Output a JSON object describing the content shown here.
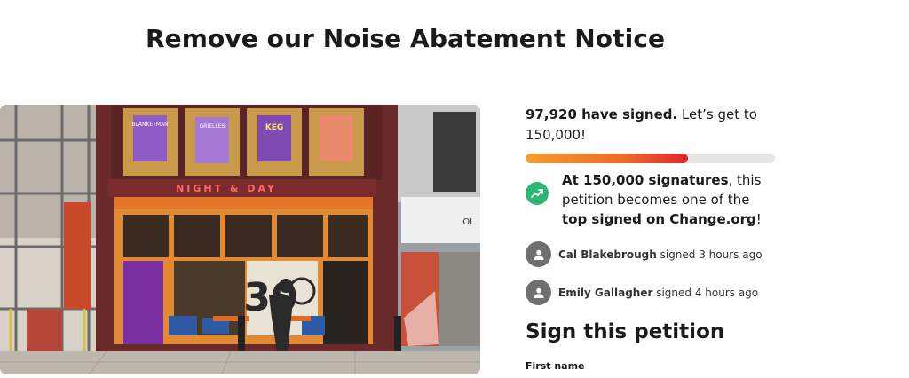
{
  "petition": {
    "title": "Remove our Noise Abatement Notice"
  },
  "photo": {
    "venue_sign": "NIGHT & DAY",
    "posters": [
      "BLANKETMAN",
      "GRIELLES",
      "KEG",
      ""
    ],
    "door_number": "30",
    "door_logo": "N D",
    "neighbor_sign": "OL"
  },
  "stats": {
    "signed_count": "97,920 have signed.",
    "goal_text": " Let’s get to 150,000!",
    "progress": 0.65
  },
  "milestone": {
    "lead_bold": "At 150,000 signatures",
    "middle": ", this petition becomes one of the ",
    "top_bold": "top signed on Change.org",
    "end": "!"
  },
  "recent_signers": [
    {
      "name": "Cal Blakebrough",
      "time": " signed 3 hours ago"
    },
    {
      "name": "Emily Gallagher",
      "time": " signed 4 hours ago"
    }
  ],
  "form": {
    "heading": "Sign this petition",
    "first_name_label": "First name"
  },
  "colors": {
    "progress_start": "#f59d2a",
    "progress_end": "#e0262e",
    "milestone_icon": "#2bb673",
    "avatar": "#6f6f6f"
  },
  "icons": {
    "milestone": "trending-up-icon",
    "signer": "user-avatar-icon"
  }
}
